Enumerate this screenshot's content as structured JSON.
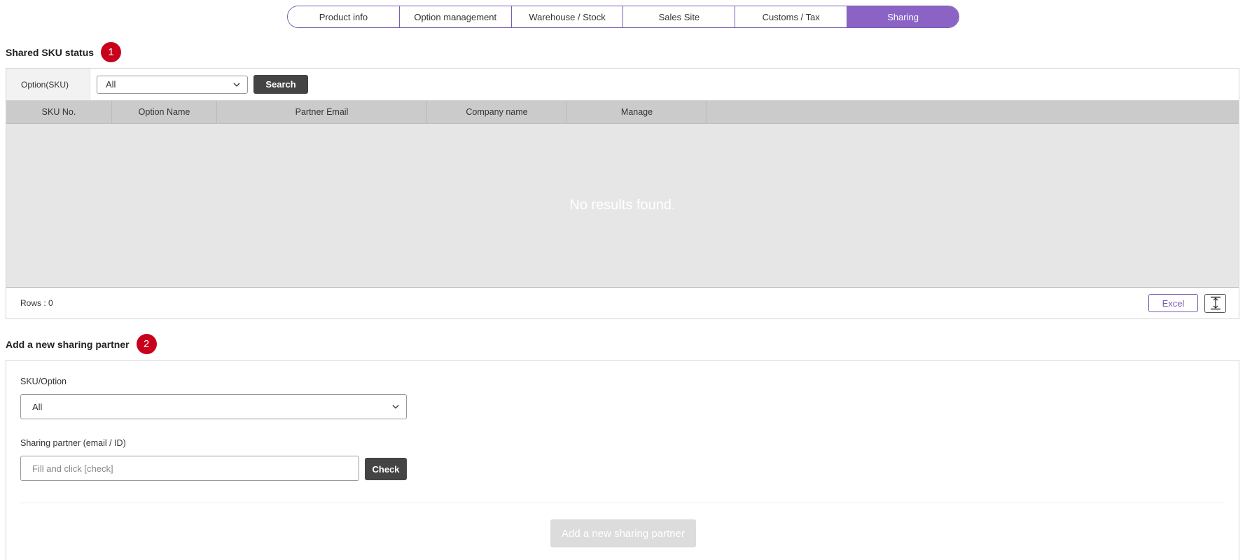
{
  "tabs": [
    {
      "label": "Product info",
      "active": false
    },
    {
      "label": "Option management",
      "active": false
    },
    {
      "label": "Warehouse / Stock",
      "active": false
    },
    {
      "label": "Sales Site",
      "active": false
    },
    {
      "label": "Customs / Tax",
      "active": false
    },
    {
      "label": "Sharing",
      "active": true
    }
  ],
  "section1": {
    "title": "Shared SKU status",
    "badge": "1",
    "filter_label": "Option(SKU)",
    "filter_value": "All",
    "search_label": "Search",
    "columns": [
      "SKU No.",
      "Option Name",
      "Partner Email",
      "Company name",
      "Manage"
    ],
    "empty_message": "No results found.",
    "rows_label": "Rows : 0",
    "excel_label": "Excel"
  },
  "section2": {
    "title": "Add a new sharing partner",
    "badge": "2",
    "sku_label": "SKU/Option",
    "sku_value": "All",
    "partner_label": "Sharing partner (email / ID)",
    "partner_placeholder": "Fill and click [check]",
    "check_label": "Check",
    "submit_label": "Add a new sharing partner"
  },
  "colors": {
    "accent": "#8a63c5",
    "badge": "#c9001c",
    "dark_button": "#444444"
  },
  "icons": [
    "chevron-down-icon",
    "vertical-resize-icon"
  ]
}
